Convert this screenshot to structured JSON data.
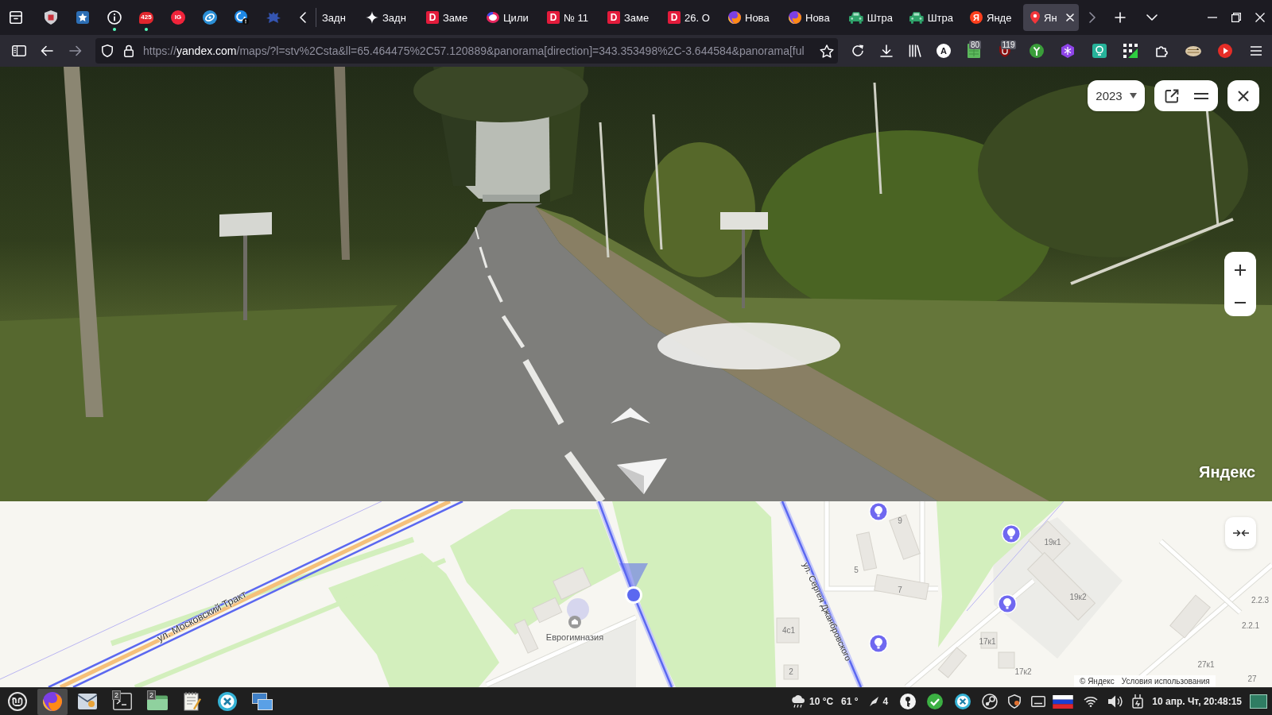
{
  "tab_strip": {
    "pinned_tabs": [
      {
        "kind": "shield",
        "attention": false
      },
      {
        "kind": "star",
        "attention": false
      },
      {
        "kind": "info",
        "attention": true
      },
      {
        "kind": "mail",
        "badge": "425",
        "attention": true
      },
      {
        "kind": "logo",
        "icon_text": "IG",
        "attention": false
      },
      {
        "kind": "compass",
        "attention": false
      },
      {
        "kind": "alert",
        "attention": false
      },
      {
        "kind": "emblem",
        "attention": false
      }
    ],
    "tabs": [
      {
        "kind": "none",
        "title": "Задн",
        "selected": false
      },
      {
        "kind": "sparkle",
        "title": "Задн",
        "selected": false
      },
      {
        "kind": "letter",
        "icon_text": "D",
        "title": "Заме",
        "selected": false
      },
      {
        "kind": "ring",
        "title": "Цили",
        "selected": false
      },
      {
        "kind": "letter",
        "icon_text": "D",
        "title": "№ 11",
        "selected": false
      },
      {
        "kind": "letter",
        "icon_text": "D",
        "title": "Заме",
        "selected": false
      },
      {
        "kind": "letter",
        "icon_text": "D",
        "title": "26. О",
        "selected": false
      },
      {
        "kind": "firefox",
        "title": "Нова",
        "selected": false
      },
      {
        "kind": "firefox",
        "title": "Нова",
        "selected": false
      },
      {
        "kind": "car",
        "title": "Штра",
        "selected": false
      },
      {
        "kind": "car",
        "title": "Штра",
        "selected": false
      },
      {
        "kind": "yandex",
        "icon_text": "Я",
        "title": "Янде",
        "selected": false
      },
      {
        "kind": "pin",
        "title": "Ян",
        "selected": true
      }
    ]
  },
  "nav_bar": {
    "buttons": [
      {
        "kind": "back",
        "disabled": false
      },
      {
        "kind": "forward",
        "disabled": true
      }
    ],
    "url": {
      "scheme": "https://",
      "host": "yandex.com",
      "path": "/maps/?l=stv%2Csta&ll=65.464475%2C57.120889&panorama[direction]=343.353498%2C-3.644584&panorama[ful"
    },
    "bookmarked": false,
    "extensions": [
      {
        "kind": "letter",
        "icon_text": "A"
      },
      {
        "kind": "sheet",
        "badge": "80"
      },
      {
        "kind": "shield",
        "badge": "119"
      }
    ]
  },
  "panorama": {
    "year": "2023",
    "logo": "Яндекс"
  },
  "map": {
    "streets": [
      "ул. Московский Тракт",
      "ул. Сергея Джанбровского"
    ],
    "place": "Еврогимназия",
    "house_numbers": [
      "9",
      "5",
      "7",
      "19к1",
      "19к2",
      "4с1",
      "2",
      "17к1",
      "17к2",
      "2.2.3",
      "2.2.1",
      "27к1",
      "27"
    ],
    "attribution": {
      "copyright": "© Яндекс",
      "terms": "Условия использования"
    }
  },
  "taskbar": {
    "apps": [
      {
        "kind": "firefox",
        "active": true
      },
      {
        "kind": "mail",
        "active": false
      },
      {
        "kind": "terminal",
        "badge": "2",
        "active": false
      },
      {
        "kind": "files",
        "badge": "2",
        "active": false
      },
      {
        "kind": "editor",
        "active": false
      },
      {
        "kind": "xapp",
        "active": false
      },
      {
        "kind": "windows",
        "active": false
      }
    ],
    "weather": {
      "temperature": "10 °C",
      "humidity": "61 °"
    },
    "notifications": "4",
    "clock": "10 апр. Чт, 20:48:15"
  }
}
